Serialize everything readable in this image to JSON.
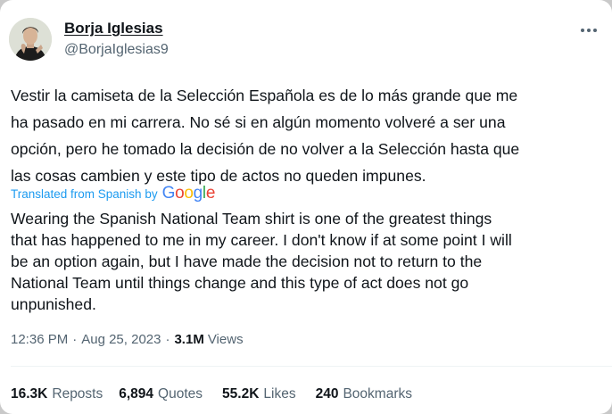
{
  "author": {
    "display_name": "Borja Iglesias",
    "handle": "@BorjaIglesias9"
  },
  "tweet": {
    "text_lines": [
      "Vestir la camiseta de la Selección Española es de lo más grande que me",
      "ha pasado en mi carrera. No sé si en algún momento volveré a ser una",
      "opción, pero he tomado la decisión de no volver a la Selección hasta que",
      "las cosas cambien y este tipo de actos no queden impunes."
    ],
    "translation_label": "Translated from Spanish by",
    "translation_provider": "Google",
    "translation_lines": [
      "Wearing the Spanish National Team shirt is one of the greatest things",
      "that has happened to me in my career. I don't know if at some point I will",
      "be an option again, but I have made the decision not to return to the",
      "National Team until things change and this type of act does not go",
      "unpunished."
    ]
  },
  "meta": {
    "time": "12:36 PM",
    "date": "Aug 25, 2023",
    "views_count": "3.1M",
    "views_label": "Views"
  },
  "stats": {
    "reposts_count": "16.3K",
    "reposts_label": "Reposts",
    "quotes_count": "6,894",
    "quotes_label": "Quotes",
    "likes_count": "55.2K",
    "likes_label": "Likes",
    "bookmarks_count": "240",
    "bookmarks_label": "Bookmarks"
  },
  "icons": {
    "more": "more-horizontal-icon",
    "logo": "google-logo"
  },
  "colors": {
    "text": "#0f1419",
    "secondary": "#536471",
    "link_blue": "#1d9bf0",
    "google_blue": "#4285f4",
    "google_red": "#ea4335",
    "google_yellow": "#fbbc05",
    "google_green": "#34a853"
  }
}
